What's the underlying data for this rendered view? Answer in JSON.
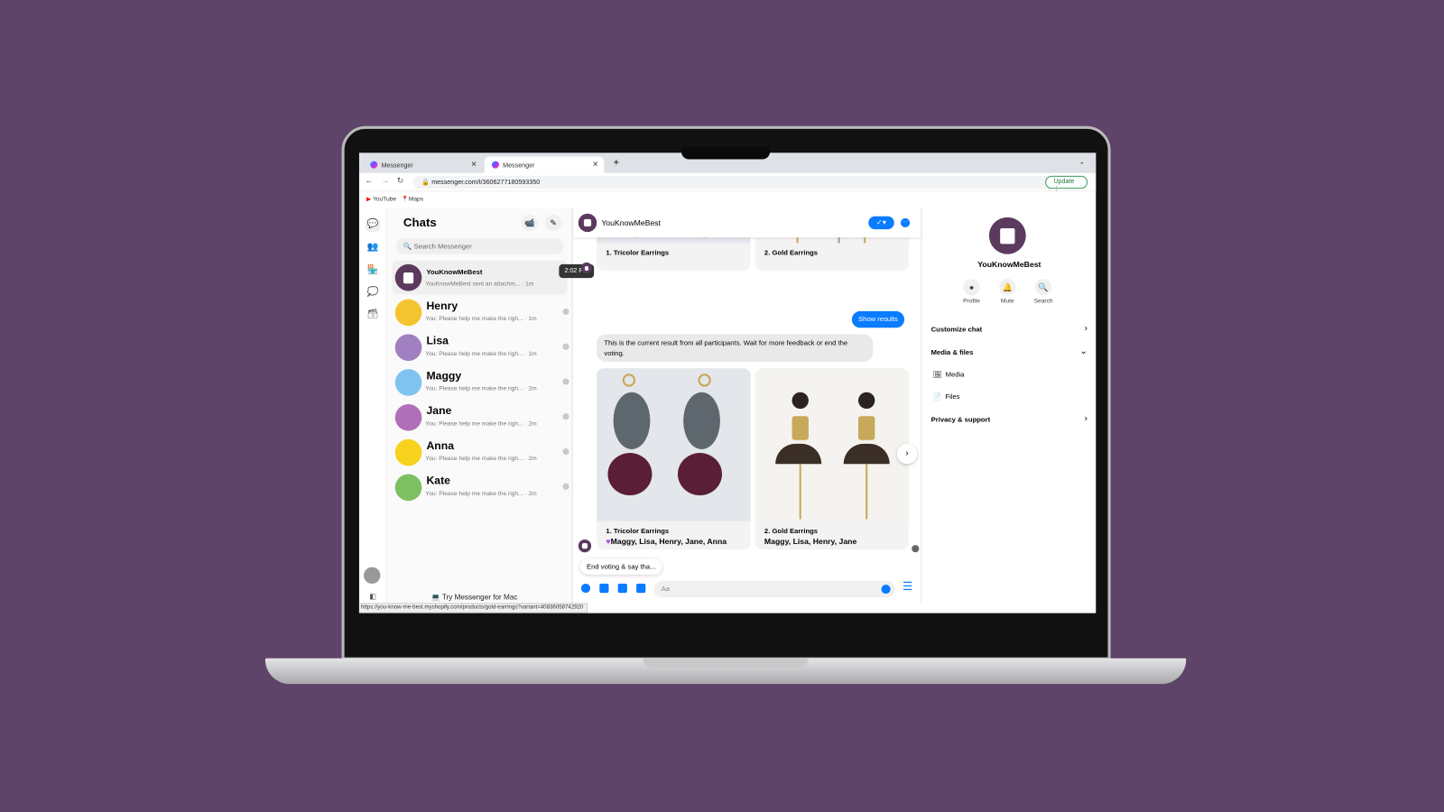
{
  "browser": {
    "tabs": [
      {
        "label": "Messenger"
      },
      {
        "label": "Messenger"
      }
    ],
    "url": "messenger.com/t/3606277180593350",
    "update_label": "Update",
    "bookmarks": [
      {
        "label": "YouTube"
      },
      {
        "label": "Maps"
      }
    ],
    "status_url": "https://you-know-me-best.myshopify.com/products/gold-earrings?variant=40836058742920"
  },
  "chats": {
    "title": "Chats",
    "search_placeholder": "Search Messenger",
    "tooltip": "2:02 PM",
    "try_mac": "Try Messenger for Mac",
    "items": [
      {
        "name": "YouKnowMeBest",
        "preview": "YouKnowMeBest sent an attachm... · 1m"
      },
      {
        "name": "Henry",
        "preview": "You: Please help me make the righ... · 1m"
      },
      {
        "name": "Lisa",
        "preview": "You: Please help me make the righ... · 1m"
      },
      {
        "name": "Maggy",
        "preview": "You: Please help me make the righ... · 2m"
      },
      {
        "name": "Jane",
        "preview": "You: Please help me make the righ... · 2m"
      },
      {
        "name": "Anna",
        "preview": "You: Please help me make the righ... · 2m"
      },
      {
        "name": "Kate",
        "preview": "You: Please help me make the righ... · 2m"
      }
    ]
  },
  "conversation": {
    "name": "YouKnowMeBest",
    "top_cards": [
      {
        "title": "1. Tricolor Earrings"
      },
      {
        "title": "2. Gold Earrings"
      }
    ],
    "show_results": "Show results",
    "result_message": "This is the current result from all participants. Wait for more feedback or end the voting.",
    "result_cards": [
      {
        "title": "1. Tricolor Earrings",
        "votes": "Maggy, Lisa, Henry, Jane, Anna",
        "winner": true
      },
      {
        "title": "2. Gold Earrings",
        "votes": "Maggy, Lisa, Henry, Jane"
      }
    ],
    "quick_reply": "End voting & say tha...",
    "composer_placeholder": "Aa",
    "accent": "#0a7cff"
  },
  "info": {
    "name": "YouKnowMeBest",
    "actions": [
      {
        "label": "Profile"
      },
      {
        "label": "Mute"
      },
      {
        "label": "Search"
      }
    ],
    "customize": "Customize chat",
    "media_files": "Media & files",
    "media": "Media",
    "files": "Files",
    "privacy": "Privacy & support"
  }
}
